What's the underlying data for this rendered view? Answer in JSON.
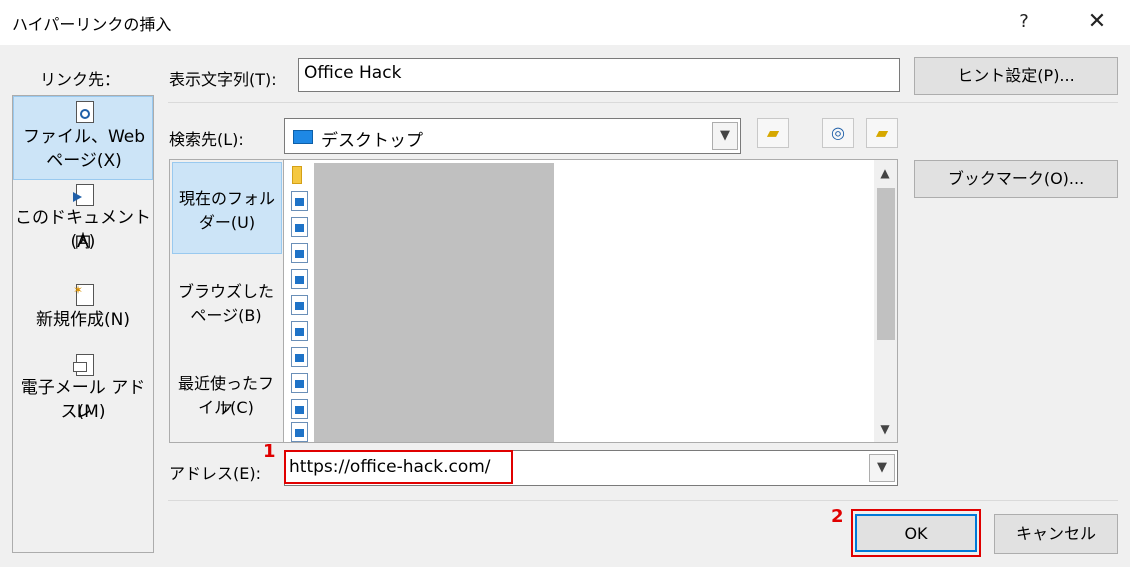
{
  "window": {
    "title": "ハイパーリンクの挿入",
    "help_glyph": "?",
    "close_glyph": "✕"
  },
  "link_to": {
    "label": "リンク先：",
    "items": [
      {
        "line1": "ファイル、Web",
        "line2": "ページ(X)",
        "selected": true,
        "icon": "file-web-icon"
      },
      {
        "line1": "このドキュメント内",
        "line2": "(A)",
        "selected": false,
        "icon": "place-in-document-icon"
      },
      {
        "line1": "新規作成(N)",
        "line2": "",
        "selected": false,
        "icon": "new-document-icon"
      },
      {
        "line1": "電子メール アドレ",
        "line2": "ス(M)",
        "selected": false,
        "icon": "email-icon"
      }
    ]
  },
  "text_to_display": {
    "label": "表示文字列(T):",
    "value": "Office Hack"
  },
  "screentip_button": "ヒント設定(P)...",
  "look_in": {
    "label": "検索先(L):",
    "value": "デスクトップ"
  },
  "file_nav": [
    {
      "line1": "現在のフォル",
      "line2": "ダー(U)",
      "selected": true
    },
    {
      "line1": "ブラウズした",
      "line2": "ページ(B)",
      "selected": false
    },
    {
      "line1": "最近使ったファ",
      "line2": "イル(C)",
      "selected": false
    }
  ],
  "file_list_icons": [
    "folder-icon",
    "image-file-icon",
    "image-file-icon",
    "image-file-icon",
    "image-file-icon",
    "image-file-icon",
    "image-file-icon",
    "image-file-icon",
    "image-file-icon",
    "image-file-icon",
    "image-file-icon"
  ],
  "bookmark_button": "ブックマーク(O)...",
  "address": {
    "label": "アドレス(E):",
    "value": "https://office-hack.com/"
  },
  "annotations": {
    "step1": "1",
    "step2": "2"
  },
  "ok_button": "OK",
  "cancel_button": "キャンセル",
  "colors": {
    "highlight": "#e00000",
    "selected_bg": "#cce4f7"
  }
}
